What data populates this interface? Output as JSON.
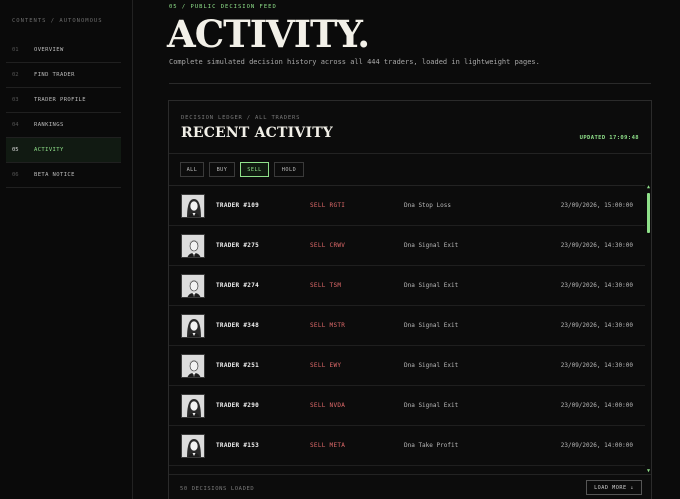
{
  "sidebar": {
    "heading": "CONTENTS / AUTONOMOUS",
    "items": [
      {
        "num": "01",
        "label": "OVERVIEW",
        "active": false
      },
      {
        "num": "02",
        "label": "FIND TRADER",
        "active": false
      },
      {
        "num": "03",
        "label": "TRADER PROFILE",
        "active": false
      },
      {
        "num": "04",
        "label": "RANKINGS",
        "active": false
      },
      {
        "num": "05",
        "label": "ACTIVITY",
        "active": true
      },
      {
        "num": "06",
        "label": "BETA NOTICE",
        "active": false
      }
    ]
  },
  "header": {
    "eyebrow": "05 / PUBLIC DECISION FEED",
    "title": "ACTIVITY.",
    "subtitle": "Complete simulated decision history across all 444 traders, loaded in lightweight pages."
  },
  "panel": {
    "crumb": "DECISION LEDGER / ALL TRADERS",
    "title": "RECENT ACTIVITY",
    "updated": "UPDATED 17:09:48",
    "filters": [
      {
        "label": "ALL",
        "active": false
      },
      {
        "label": "BUY",
        "active": false
      },
      {
        "label": "SELL",
        "active": true
      },
      {
        "label": "HOLD",
        "active": false
      }
    ],
    "rows": [
      {
        "trader": "TRADER #109",
        "action": "SELL RGTI",
        "reason": "Dna Stop Loss",
        "time": "23/09/2026, 15:00:00",
        "avatar": "female"
      },
      {
        "trader": "TRADER #275",
        "action": "SELL CRWV",
        "reason": "Dna Signal Exit",
        "time": "23/09/2026, 14:30:00",
        "avatar": "male"
      },
      {
        "trader": "TRADER #274",
        "action": "SELL TSM",
        "reason": "Dna Signal Exit",
        "time": "23/09/2026, 14:30:00",
        "avatar": "male"
      },
      {
        "trader": "TRADER #348",
        "action": "SELL MSTR",
        "reason": "Dna Signal Exit",
        "time": "23/09/2026, 14:30:00",
        "avatar": "female"
      },
      {
        "trader": "TRADER #251",
        "action": "SELL EWY",
        "reason": "Dna Signal Exit",
        "time": "23/09/2026, 14:30:00",
        "avatar": "male"
      },
      {
        "trader": "TRADER #290",
        "action": "SELL NVDA",
        "reason": "Dna Signal Exit",
        "time": "23/09/2026, 14:00:00",
        "avatar": "female"
      },
      {
        "trader": "TRADER #153",
        "action": "SELL META",
        "reason": "Dna Take Profit",
        "time": "23/09/2026, 14:00:00",
        "avatar": "female"
      },
      {
        "trader": "",
        "action": "",
        "reason": "",
        "time": "",
        "avatar": "female"
      }
    ],
    "footer_loaded": "50 DECISIONS LOADED",
    "load_more": "LOAD MORE ↓"
  },
  "colors": {
    "accent": "#8fe08a",
    "sell": "#e06a6a",
    "background": "#0b0b0b"
  }
}
